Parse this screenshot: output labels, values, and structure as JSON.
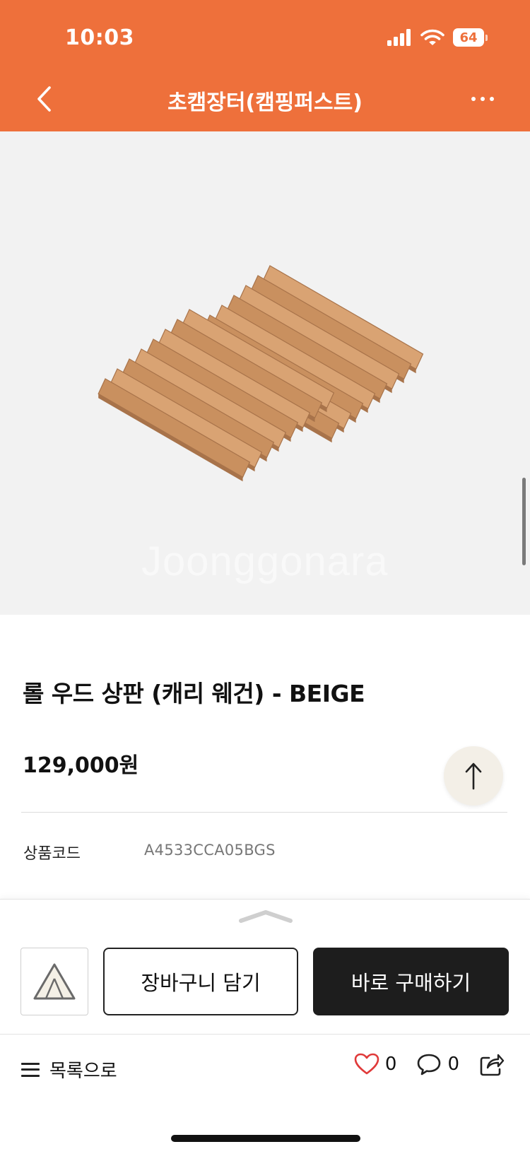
{
  "status_bar": {
    "time": "10:03",
    "battery_level": "64",
    "icons": [
      "cellular-signal-icon",
      "wifi-icon",
      "battery-icon"
    ]
  },
  "nav": {
    "title": "초캠장터(캠핑퍼스트)",
    "back_icon": "chevron-left-icon",
    "more_icon": "more-horizontal-icon"
  },
  "product": {
    "image_watermark": "Joonggonara",
    "title": "롤 우드 상판 (캐리 웨건) - BEIGE",
    "price": "129,000원",
    "code_label": "상품코드",
    "code_value": "A4533CCA05BGS"
  },
  "purchase_panel": {
    "cart_label": "장바구니 담기",
    "buy_label": "바로 구매하기",
    "list_label": "목록으로",
    "like_count": "0",
    "comment_count": "0"
  },
  "colors": {
    "brand": "#ee703b",
    "buy_button": "#1d1d1d",
    "like_icon": "#e03a3a",
    "wood": "#c9905f"
  }
}
